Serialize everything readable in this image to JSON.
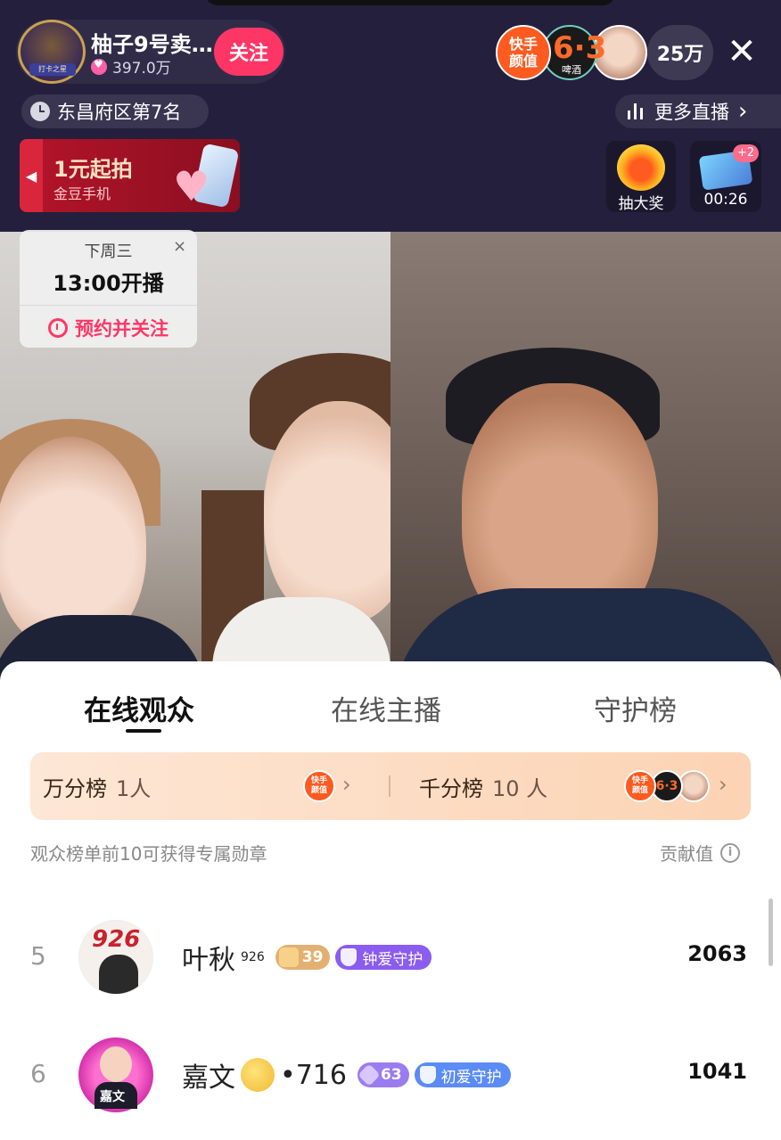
{
  "header": {
    "host_name": "柚子9号卖…",
    "host_likes": "397.0万",
    "host_avatar_ribbon": "打卡之星",
    "follow_label": "关注",
    "badge_kuaishou": "快手\n颜值",
    "badge_beer_number": "6·3",
    "badge_beer_text": "啤酒",
    "viewer_count": "25万",
    "close_glyph": "✕",
    "rank_text": "东昌府区第7名",
    "more_live_label": "更多直播",
    "more_live_chevron": "›",
    "promo_title": "1元起拍",
    "promo_subtitle": "金豆手机",
    "promo_arrow": "◀",
    "lottery_label": "抽大奖",
    "timer_plus": "+2",
    "timer_label": "00:26"
  },
  "schedule": {
    "day": "下周三",
    "time": "13:00开播",
    "reserve_label": "预约并关注",
    "close_glyph": "×"
  },
  "panel": {
    "tabs": [
      {
        "label": "在线观众",
        "active": true
      },
      {
        "label": "在线主播",
        "active": false
      },
      {
        "label": "守护榜",
        "active": false
      }
    ],
    "tier_left_label": "万分榜",
    "tier_left_count": "1人",
    "tier_right_label": "千分榜",
    "tier_right_count": "10 人",
    "tier_badge_kuaishou": "快手\n颜值",
    "tier_badge_beer": "6·3",
    "chevron": "›",
    "hint": "观众榜单前10可获得专属勋章",
    "contribution_label": "贡献值",
    "info_glyph": "i"
  },
  "viewers": [
    {
      "rank": "5",
      "name": "叶秋",
      "name_suffix": "926",
      "level": "39",
      "guard": "钟爱守护",
      "score": "2063",
      "level_color": "#e2b070",
      "guard_color": "#8a5cf0",
      "avatar_text": "926"
    },
    {
      "rank": "6",
      "name": "嘉文",
      "name_suffix": "•716",
      "level": "63",
      "guard": "初爱守护",
      "score": "1041",
      "level_color": "#9a7cf0",
      "guard_color": "#5b8cf5",
      "avatar_text": "嘉文"
    }
  ],
  "colors": {
    "accent": "#fe3666",
    "background_dark": "#241f3d"
  }
}
